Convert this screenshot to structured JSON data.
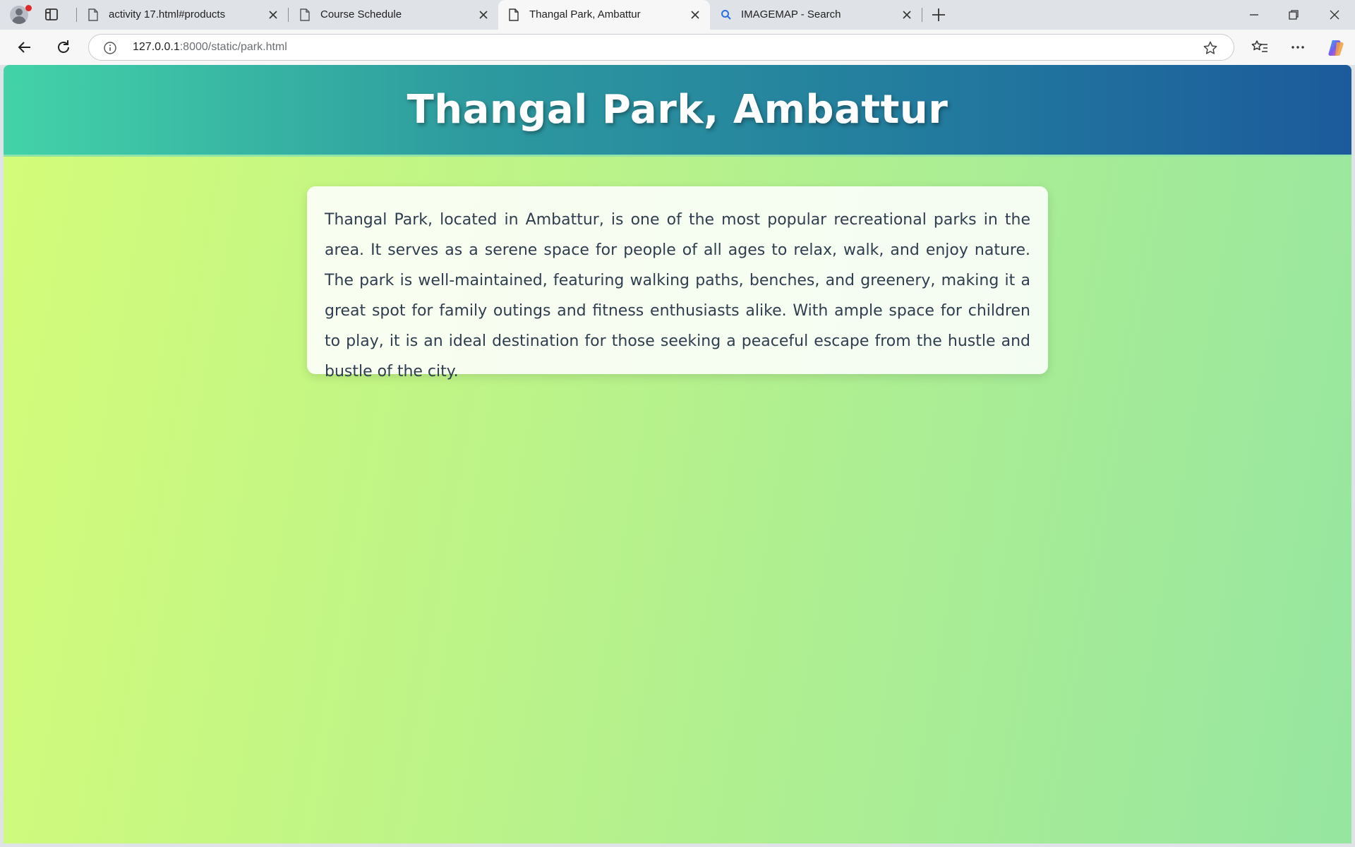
{
  "browser": {
    "tabs": [
      {
        "title": "activity 17.html#products",
        "active": false,
        "icon": "page-icon"
      },
      {
        "title": "Course Schedule",
        "active": false,
        "icon": "page-icon"
      },
      {
        "title": "Thangal Park, Ambattur",
        "active": true,
        "icon": "page-icon"
      },
      {
        "title": "IMAGEMAP - Search",
        "active": false,
        "icon": "search-icon"
      }
    ],
    "address": {
      "host": "127.0.0.1",
      "rest": ":8000/static/park.html"
    }
  },
  "page": {
    "title": "Thangal Park, Ambattur",
    "description": "Thangal Park, located in Ambattur, is one of the most popular recreational parks in the area. It serves as a serene space for people of all ages to relax, walk, and enjoy nature. The park is well-maintained, featuring walking paths, benches, and greenery, making it a great spot for family outings and fitness enthusiasts alike. With ample space for children to play, it is an ideal destination for those seeking a peaceful escape from the hustle and bustle of the city."
  },
  "colors": {
    "header_gradient_start": "#43d3a8",
    "header_gradient_end": "#1c5a9c",
    "background_gradient_start": "#d4fc79",
    "background_gradient_end": "#96e6a1",
    "text": "#2f3e4f"
  }
}
